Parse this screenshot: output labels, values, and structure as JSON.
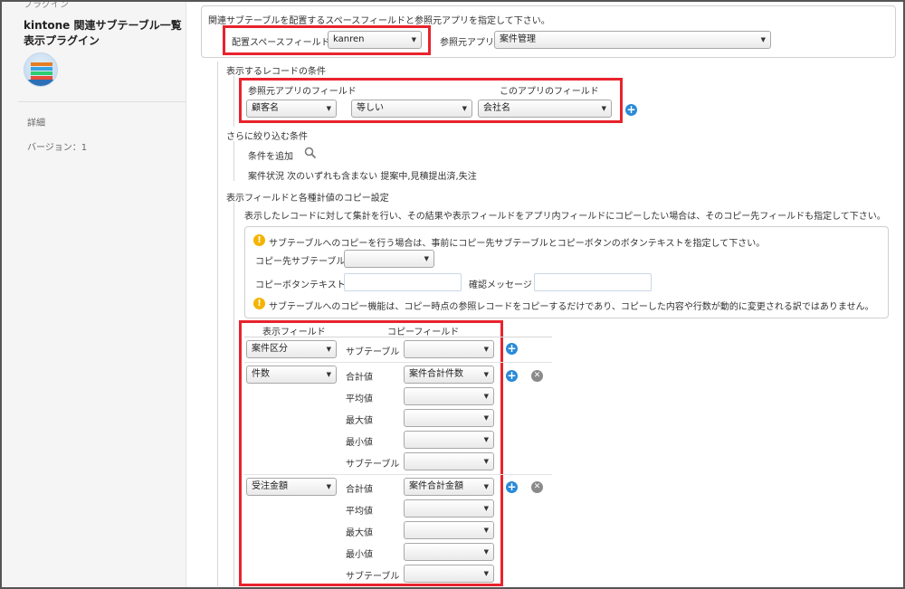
{
  "sidebar": {
    "top_label": "プラグイン",
    "title_line1": "kintone 関連サブテーブル一覧",
    "title_line2": "表示プラグイン",
    "icon": "plugin-app-icon",
    "detail_link": "詳細",
    "version": "バージョン：1"
  },
  "space": {
    "instruction": "関連サブテーブルを配置するスペースフィールドと参照元アプリを指定して下さい。",
    "space_field_label": "配置スペースフィールド",
    "space_field_value": "kanren",
    "ref_app_label": "参照元アプリ",
    "ref_app_value": "案件管理"
  },
  "condition": {
    "heading": "表示するレコードの条件",
    "ref_field_header": "参照元アプリのフィールド",
    "this_field_header": "このアプリのフィールド",
    "ref_field_value": "顧客名",
    "operator_value": "等しい",
    "this_field_value": "会社名"
  },
  "filter": {
    "heading": "さらに絞り込む条件",
    "add_label": "条件を追加",
    "summary": "案件状況 次のいずれも含まない 提案中,見積提出済,失注"
  },
  "copy": {
    "heading": "表示フィールドと各種計値のコピー設定",
    "description": "表示したレコードに対して集計を行い、その結果や表示フィールドをアプリ内フィールドにコピーしたい場合は、そのコピー先フィールドも指定して下さい。",
    "notice": "サブテーブルへのコピーを行う場合は、事前にコピー先サブテーブルとコピーボタンのボタンテキストを指定して下さい。",
    "dest_subtable_label": "コピー先サブテーブル",
    "button_text_label": "コピーボタンテキスト",
    "confirm_label": "確認メッセージ",
    "warning": "サブテーブルへのコピー機能は、コピー時点の参照レコードをコピーするだけであり、コピーした内容や行数が動的に変更される訳ではありません。"
  },
  "mapping": {
    "display_header": "表示フィールド",
    "copy_header": "コピーフィールド",
    "rows": [
      {
        "field": "案件区分",
        "items": [
          {
            "label": "サブテーブル",
            "value": ""
          }
        ]
      },
      {
        "field": "件数",
        "items": [
          {
            "label": "合計値",
            "value": "案件合計件数"
          },
          {
            "label": "平均値",
            "value": ""
          },
          {
            "label": "最大値",
            "value": ""
          },
          {
            "label": "最小値",
            "value": ""
          },
          {
            "label": "サブテーブル",
            "value": ""
          }
        ]
      },
      {
        "field": "受注金額",
        "items": [
          {
            "label": "合計値",
            "value": "案件合計金額"
          },
          {
            "label": "平均値",
            "value": ""
          },
          {
            "label": "最大値",
            "value": ""
          },
          {
            "label": "最小値",
            "value": ""
          },
          {
            "label": "サブテーブル",
            "value": ""
          }
        ]
      }
    ]
  },
  "icons": {
    "add": "plus-circle-icon",
    "remove": "x-circle-icon",
    "search": "search-icon",
    "warning": "warning-icon",
    "caret": "▼"
  },
  "colors": {
    "highlight": "#e8232c",
    "accent": "#2a8ad8",
    "warning_text": "#e22121"
  }
}
